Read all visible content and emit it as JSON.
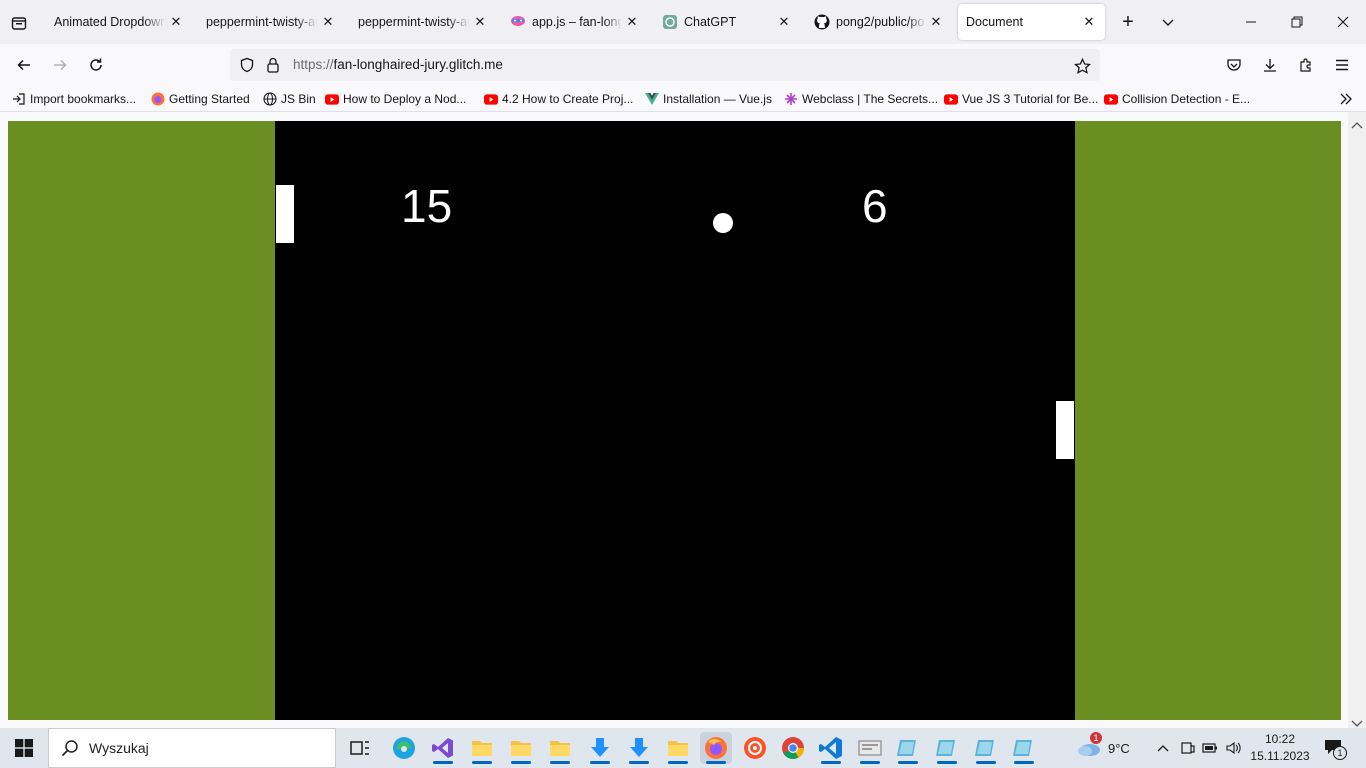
{
  "tabs": [
    {
      "label": "Animated Dropdown"
    },
    {
      "label": "peppermint-twisty-ag"
    },
    {
      "label": "peppermint-twisty-ag"
    },
    {
      "label": "app.js – fan-longh"
    },
    {
      "label": "ChatGPT"
    },
    {
      "label": "pong2/public/po"
    },
    {
      "label": "Document"
    }
  ],
  "address": {
    "protocol": "https://",
    "host": "fan-longhaired-jury.glitch.me"
  },
  "bookmarks": [
    {
      "label": "Import bookmarks..."
    },
    {
      "label": "Getting Started"
    },
    {
      "label": "JS Bin"
    },
    {
      "label": "How to Deploy a Nod..."
    },
    {
      "label": "4.2 How to Create Proj..."
    },
    {
      "label": "Installation — Vue.js"
    },
    {
      "label": "Webclass | The Secrets..."
    },
    {
      "label": "Vue JS 3 Tutorial for Be..."
    },
    {
      "label": "Collision Detection - E..."
    }
  ],
  "game": {
    "score_left": "15",
    "score_right": "6"
  },
  "colors": {
    "page_background": "#6b8e23",
    "game_background": "#000000",
    "accent": "#0067c0"
  },
  "taskbar": {
    "search_placeholder": "Wyszukaj",
    "weather_temp": "9°C",
    "weather_badge": "1",
    "time": "10:22",
    "date": "15.11.2023",
    "notification_count": "1"
  }
}
